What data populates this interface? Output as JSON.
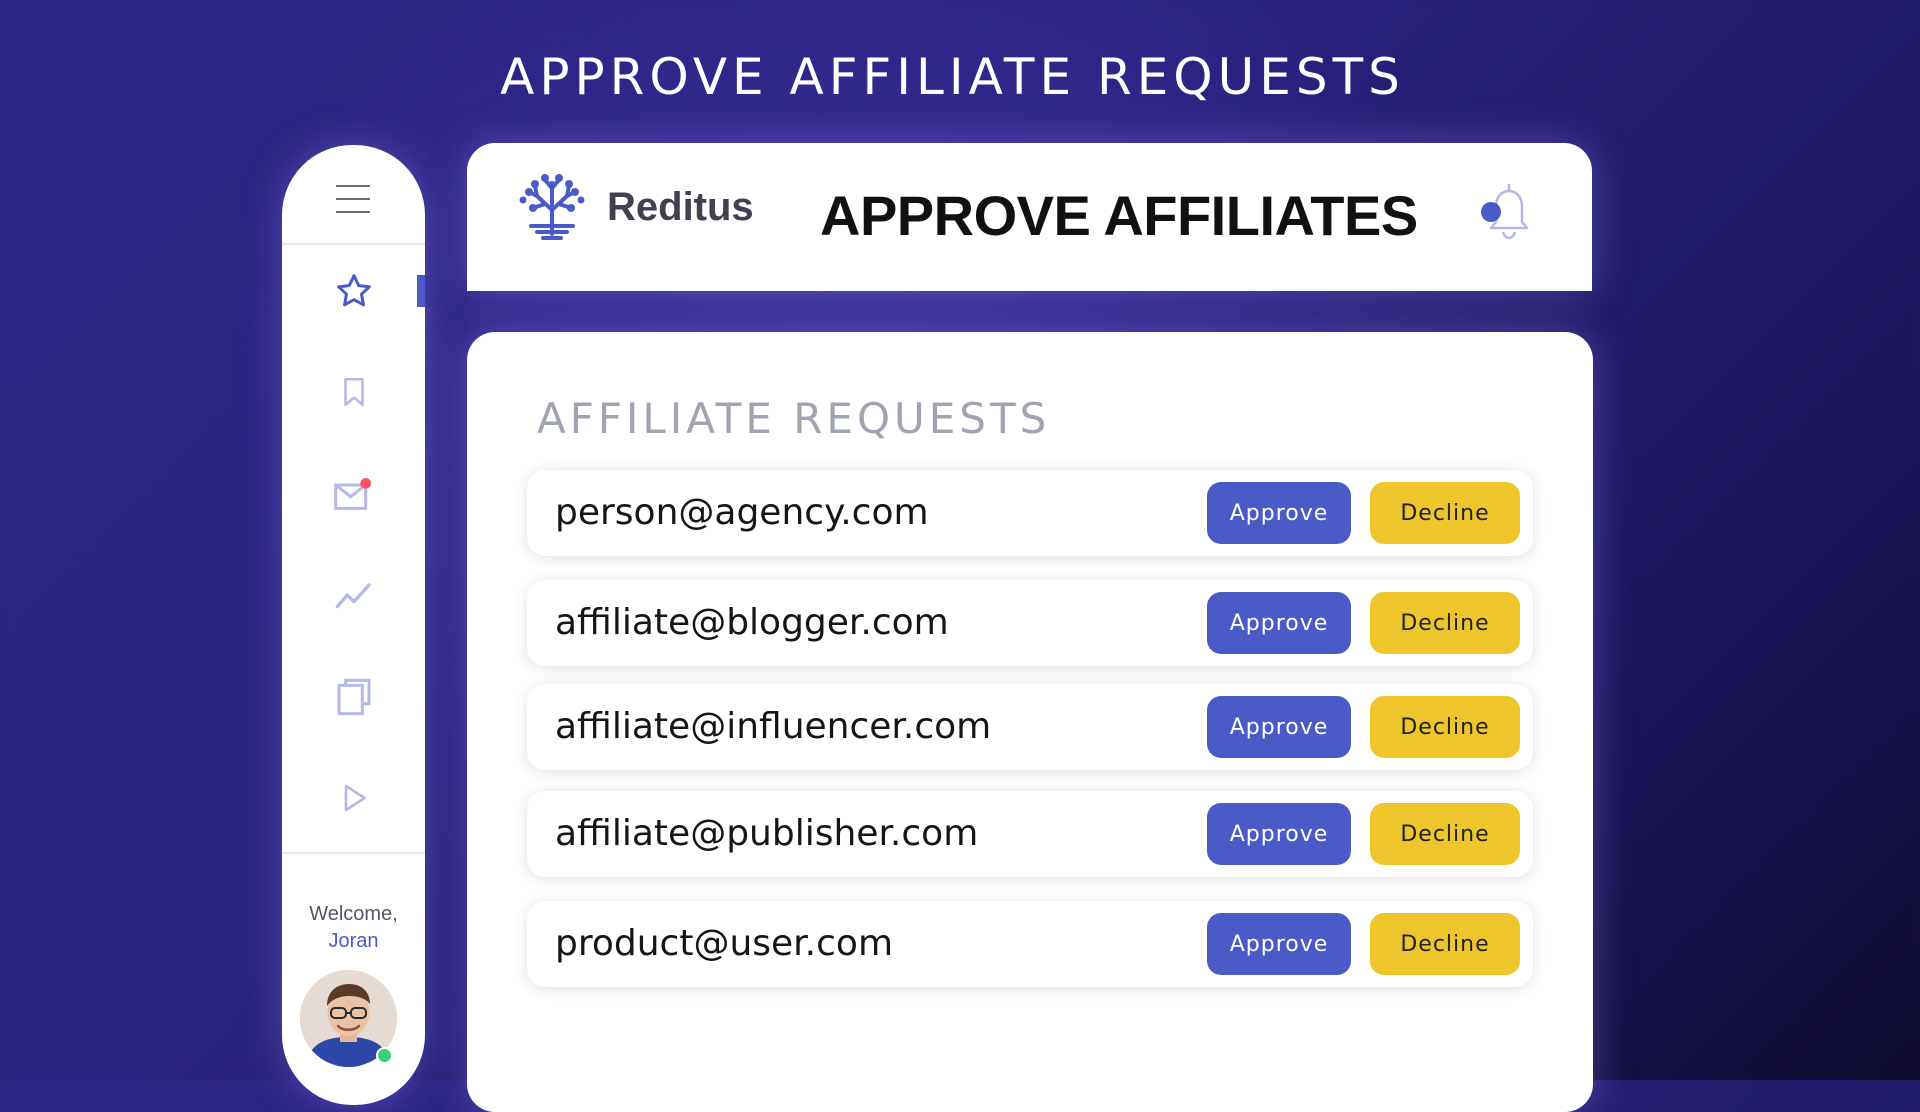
{
  "headline": "APPROVE AFFILIATE REQUESTS",
  "header": {
    "brand": "Reditus",
    "title": "APPROVE AFFILIATES"
  },
  "sidebar": {
    "items": [
      {
        "icon": "star-icon",
        "active": true
      },
      {
        "icon": "bookmark-icon",
        "active": false
      },
      {
        "icon": "mail-icon",
        "active": false,
        "badge": true
      },
      {
        "icon": "trend-icon",
        "active": false
      },
      {
        "icon": "document-icon",
        "active": false
      },
      {
        "icon": "play-icon",
        "active": false
      }
    ],
    "welcome_label": "Welcome,",
    "user_name": "Joran"
  },
  "requests": {
    "title": "AFFILIATE REQUESTS",
    "approve_label": "Approve",
    "decline_label": "Decline",
    "rows": [
      {
        "email": "person@agency.com"
      },
      {
        "email": "affiliate@blogger.com"
      },
      {
        "email": "affiliate@influencer.com"
      },
      {
        "email": "affiliate@publisher.com"
      },
      {
        "email": "product@user.com"
      }
    ]
  },
  "colors": {
    "accent": "#4a5bc7",
    "decline": "#eec62c",
    "background": "#2d2585",
    "badge": "#ff4f6d",
    "online": "#3ad07a"
  }
}
